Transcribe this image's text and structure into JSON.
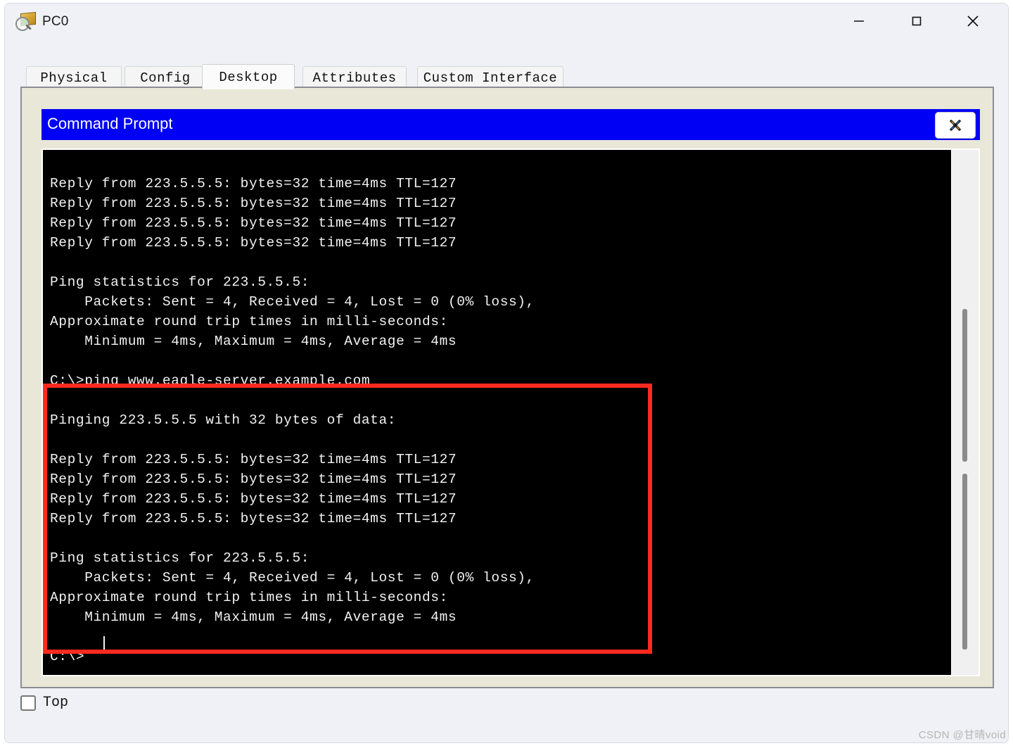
{
  "window": {
    "title": "PC0",
    "icon": "device-inspect-icon",
    "controls": {
      "minimize": "minimize-icon",
      "maximize": "maximize-icon",
      "close": "close-icon"
    }
  },
  "tabs": [
    {
      "label": "Physical",
      "active": false
    },
    {
      "label": "Config",
      "active": false
    },
    {
      "label": "Desktop",
      "active": true
    },
    {
      "label": "Attributes",
      "active": false
    },
    {
      "label": "Custom Interface",
      "active": false
    }
  ],
  "command_prompt": {
    "title": "Command Prompt",
    "close_label": "X",
    "terminal_text": "Reply from 223.5.5.5: bytes=32 time=4ms TTL=127\nReply from 223.5.5.5: bytes=32 time=4ms TTL=127\nReply from 223.5.5.5: bytes=32 time=4ms TTL=127\nReply from 223.5.5.5: bytes=32 time=4ms TTL=127\n\nPing statistics for 223.5.5.5:\n    Packets: Sent = 4, Received = 4, Lost = 0 (0% loss),\nApproximate round trip times in milli-seconds:\n    Minimum = 4ms, Maximum = 4ms, Average = 4ms\n\nC:\\>ping www.eagle-server.example.com\n\nPinging 223.5.5.5 with 32 bytes of data:\n\nReply from 223.5.5.5: bytes=32 time=4ms TTL=127\nReply from 223.5.5.5: bytes=32 time=4ms TTL=127\nReply from 223.5.5.5: bytes=32 time=4ms TTL=127\nReply from 223.5.5.5: bytes=32 time=4ms TTL=127\n\nPing statistics for 223.5.5.5:\n    Packets: Sent = 4, Received = 4, Lost = 0 (0% loss),\nApproximate round trip times in milli-seconds:\n    Minimum = 4ms, Maximum = 4ms, Average = 4ms\n\nC:\\>",
    "prompt_string": "C:\\>",
    "command_entered": "ping www.eagle-server.example.com",
    "target_host": "www.eagle-server.example.com",
    "resolved_ip": "223.5.5.5",
    "packet_bytes": "32",
    "reply_time": "4ms",
    "reply_ttl": "127",
    "packets_sent": "4",
    "packets_received": "4",
    "packets_lost": "0",
    "loss_percent": "0%",
    "rtt_min": "4ms",
    "rtt_max": "4ms",
    "rtt_avg": "4ms",
    "annotation_color": "#ff2a1f"
  },
  "bottom": {
    "top_checkbox_label": "Top",
    "top_checkbox_checked": false
  },
  "watermark": "CSDN @甘晴void"
}
